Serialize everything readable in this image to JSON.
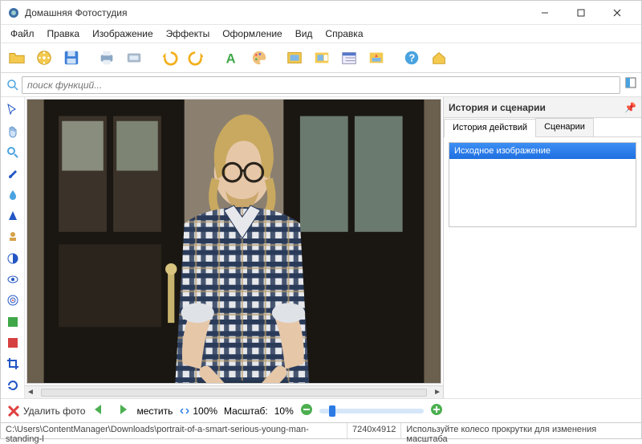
{
  "window": {
    "title": "Домашняя Фотостудия"
  },
  "menu": [
    "Файл",
    "Правка",
    "Изображение",
    "Эффекты",
    "Оформление",
    "Вид",
    "Справка"
  ],
  "search": {
    "placeholder": "поиск функций..."
  },
  "rightpanel": {
    "title": "История и сценарии",
    "tabs": {
      "history": "История действий",
      "scenarios": "Сценарии"
    },
    "history_items": [
      "Исходное изображение"
    ]
  },
  "bottom": {
    "delete_label": "Удалить фото",
    "fit_label": "местить",
    "percent100": "100%",
    "zoom_label": "Масштаб:",
    "zoom_value": "10%"
  },
  "status": {
    "path": "C:\\Users\\ContentManager\\Downloads\\portrait-of-a-smart-serious-young-man-standing-l",
    "dims": "7240x4912",
    "hint": "Используйте колесо прокрутки для изменения масштаба"
  },
  "toolbar_icons": [
    "open",
    "film",
    "save",
    "print",
    "scan",
    "undo",
    "redo",
    "text",
    "palette",
    "image",
    "calendar-image",
    "calendar",
    "star-image",
    "help",
    "home"
  ],
  "vtool_icons": [
    "pointer",
    "hand",
    "zoom",
    "brush",
    "drop",
    "triangle",
    "stamp",
    "contrast",
    "eye",
    "target",
    "swatch-green",
    "swatch-red",
    "crop",
    "rotate"
  ]
}
